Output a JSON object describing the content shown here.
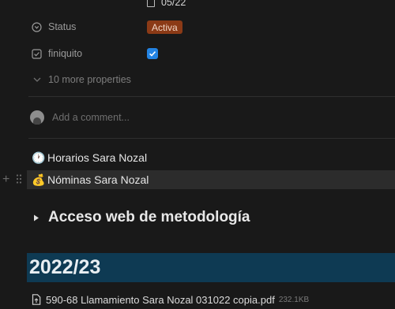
{
  "properties": {
    "date_value": "05/22",
    "status": {
      "label": "Status",
      "value": "Activa",
      "badge_color": "#8b3a16"
    },
    "finiquito": {
      "label": "finiquito",
      "checked": true,
      "check_color": "#2383e2"
    },
    "more_label": "10 more properties"
  },
  "comment": {
    "placeholder": "Add a comment..."
  },
  "links": [
    {
      "emoji": "🕐",
      "label": "Horarios Sara Nozal"
    },
    {
      "emoji": "💰",
      "label": "Nóminas Sara Nozal"
    }
  ],
  "toggle": {
    "label": "Acceso web de metodología"
  },
  "section": {
    "title": "2022/23",
    "bg_color": "#0e3a53"
  },
  "file": {
    "name": "590-68 Llamamiento Sara Nozal 031022 copia.pdf",
    "size": "232.1KB"
  }
}
